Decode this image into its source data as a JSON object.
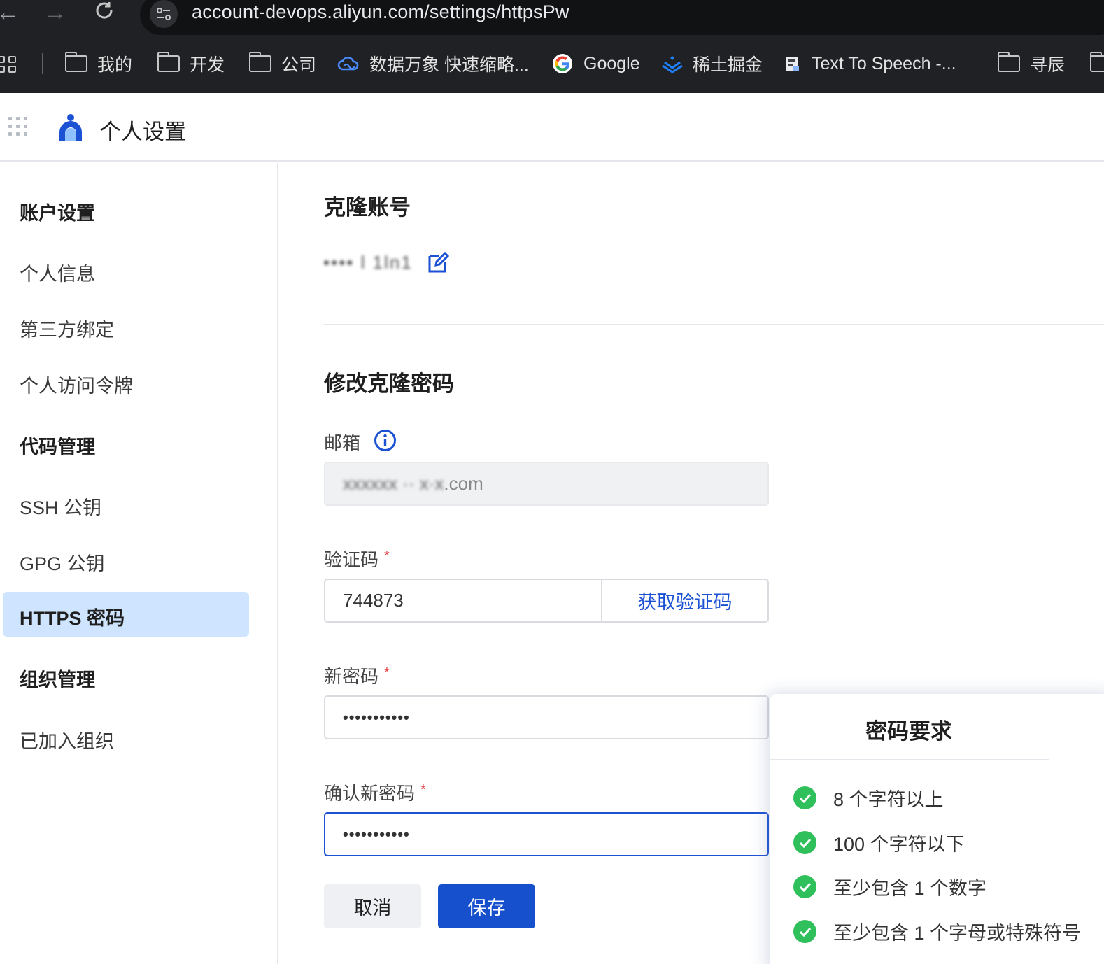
{
  "browser": {
    "url": "account-devops.aliyun.com/settings/httpsPw",
    "bookmarks": [
      {
        "label": "我的",
        "icon": "folder-icon"
      },
      {
        "label": "开发",
        "icon": "folder-icon"
      },
      {
        "label": "公司",
        "icon": "folder-icon"
      },
      {
        "label": "数据万象 快速缩略...",
        "icon": "cloud-icon"
      },
      {
        "label": "Google",
        "icon": "google-icon"
      },
      {
        "label": "稀土掘金",
        "icon": "juejin-icon"
      },
      {
        "label": "Text To Speech -...",
        "icon": "tts-icon"
      },
      {
        "label": "寻辰",
        "icon": "folder-icon"
      }
    ]
  },
  "header": {
    "title": "个人设置"
  },
  "sidebar": {
    "groups": [
      {
        "label": "账户设置",
        "items": [
          "个人信息",
          "第三方绑定",
          "个人访问令牌"
        ]
      },
      {
        "label": "代码管理",
        "items": [
          "SSH 公钥",
          "GPG 公钥",
          "HTTPS 密码"
        ]
      },
      {
        "label": "组织管理",
        "items": [
          "已加入组织"
        ]
      }
    ],
    "active_item": "HTTPS 密码"
  },
  "main": {
    "clone_account": {
      "title": "克隆账号",
      "username": "•••• l 1ln1"
    },
    "change_password": {
      "title": "修改克隆密码",
      "email_label": "邮箱",
      "email_masked": "xxxxxx ·· x·x",
      "email_suffix": ".com",
      "code_label": "验证码",
      "code_value": "744873",
      "get_code_button": "获取验证码",
      "new_password_label": "新密码",
      "new_password_value": "•••••••••••",
      "confirm_password_label": "确认新密码",
      "confirm_password_value": "•••••••••••",
      "required_mark": "*",
      "cancel_button": "取消",
      "save_button": "保存"
    }
  },
  "password_requirements": {
    "title": "密码要求",
    "items": [
      "8 个字符以上",
      "100 个字符以下",
      "至少包含 1 个数字",
      "至少包含 1 个字母或特殊符号"
    ],
    "status_color": "#2fbf5b"
  },
  "colors": {
    "primary": "#1650cc",
    "active_nav": "#cfe5ff",
    "required": "#e5484d"
  }
}
